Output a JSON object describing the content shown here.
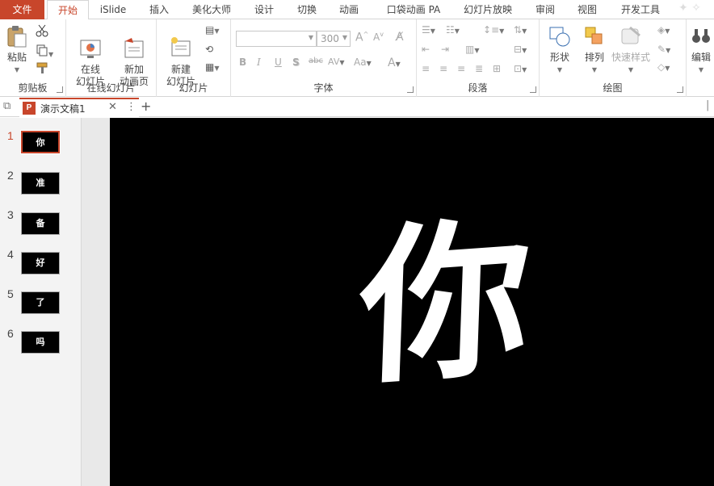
{
  "ribbon_tabs": [
    {
      "label": "文件"
    },
    {
      "label": "开始"
    },
    {
      "label": "iSlide"
    },
    {
      "label": "插入"
    },
    {
      "label": "美化大师"
    },
    {
      "label": "设计"
    },
    {
      "label": "切换"
    },
    {
      "label": "动画"
    },
    {
      "label": "口袋动画 PA"
    },
    {
      "label": "幻灯片放映"
    },
    {
      "label": "审阅"
    },
    {
      "label": "视图"
    },
    {
      "label": "开发工具"
    }
  ],
  "clipboard": {
    "paste": "粘贴",
    "group": "剪贴板"
  },
  "online_slides": {
    "online": "在线\n幻灯片",
    "new_anim": "新加\n动画页",
    "group": "在线幻灯片"
  },
  "slides_group": {
    "new_slide": "新建\n幻灯片",
    "group": "幻灯片"
  },
  "font_group": {
    "font_name": "",
    "font_size": "300",
    "group": "字体"
  },
  "paragraph_group": {
    "group": "段落"
  },
  "drawing_group": {
    "shape": "形状",
    "arrange": "排列",
    "quick_style": "快速样式",
    "group": "绘图"
  },
  "editing_group": {
    "edit": "编辑"
  },
  "document": {
    "title": "演示文稿1"
  },
  "slides": [
    {
      "number": "1",
      "text": "你"
    },
    {
      "number": "2",
      "text": "准"
    },
    {
      "number": "3",
      "text": "备"
    },
    {
      "number": "4",
      "text": "好"
    },
    {
      "number": "5",
      "text": "了"
    },
    {
      "number": "6",
      "text": "吗"
    }
  ],
  "current_slide": {
    "text": "你"
  },
  "colors": {
    "accent": "#c8462b",
    "slide_background": "#000000",
    "slide_text": "#ffffff"
  }
}
